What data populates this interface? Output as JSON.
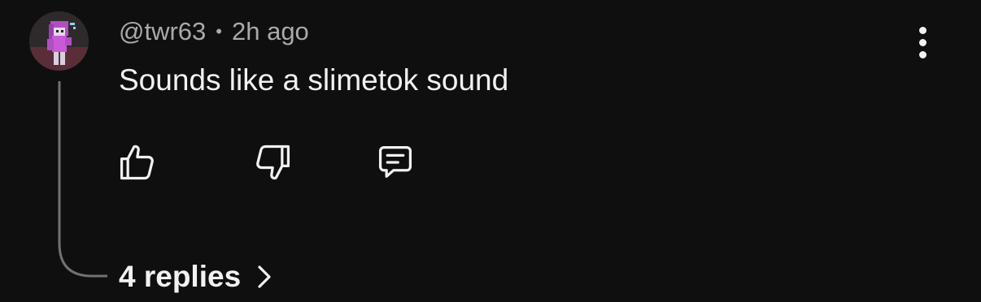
{
  "comment": {
    "author": "@twr63",
    "separator": "•",
    "timestamp": "2h ago",
    "text": "Sounds like a slimetok sound",
    "replies_label": "4 replies"
  },
  "icons": {
    "avatar": "avatar-pixel-character",
    "more": "vertical-ellipsis-icon",
    "like": "thumbs-up-icon",
    "dislike": "thumbs-down-icon",
    "reply": "comment-icon",
    "chevron": "chevron-right-icon"
  },
  "colors": {
    "background": "#0f0f0f",
    "primary_text": "#f1f1f1",
    "secondary_text": "#aaaaaa",
    "thread_line": "#717171"
  }
}
